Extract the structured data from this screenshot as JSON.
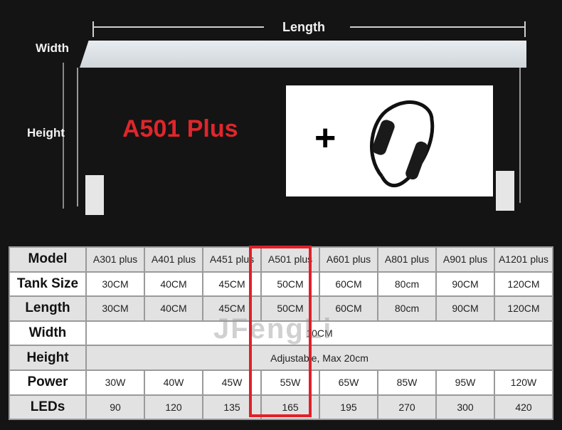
{
  "diagram": {
    "length_label": "Length",
    "width_label": "Width",
    "height_label": "Height"
  },
  "product_title": "A501 Plus",
  "accessory": {
    "plus_sign": "+",
    "icon": "dimmer-controller-cable-icon"
  },
  "watermark": "JFengLi",
  "colors": {
    "title": "#e0262b",
    "highlight": "#e02028",
    "background": "#141414"
  },
  "highlighted_model": "A501 plus",
  "table": {
    "rows": [
      {
        "label": "Model",
        "values": [
          "A301 plus",
          "A401 plus",
          "A451 plus",
          "A501 plus",
          "A601 plus",
          "A801 plus",
          "A901 plus",
          "A1201 plus"
        ]
      },
      {
        "label": "Tank Size",
        "values": [
          "30CM",
          "40CM",
          "45CM",
          "50CM",
          "60CM",
          "80cm",
          "90CM",
          "120CM"
        ]
      },
      {
        "label": "Length",
        "values": [
          "30CM",
          "40CM",
          "45CM",
          "50CM",
          "60CM",
          "80cm",
          "90CM",
          "120CM"
        ]
      },
      {
        "label": "Width",
        "span": "10CM"
      },
      {
        "label": "Height",
        "span": "Adjustable, Max 20cm"
      },
      {
        "label": "Power",
        "values": [
          "30W",
          "40W",
          "45W",
          "55W",
          "65W",
          "85W",
          "95W",
          "120W"
        ]
      },
      {
        "label": "LEDs",
        "values": [
          "90",
          "120",
          "135",
          "165",
          "195",
          "270",
          "300",
          "420"
        ]
      }
    ]
  }
}
